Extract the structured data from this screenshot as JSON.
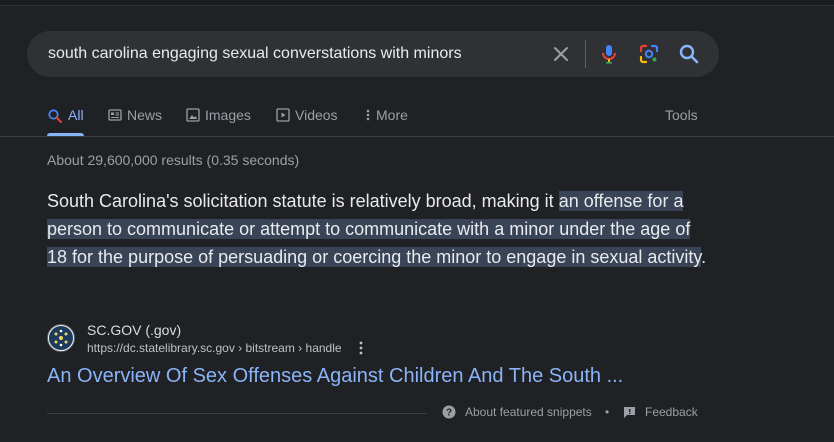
{
  "search": {
    "query": "south carolina engaging sexual converstations with minors"
  },
  "tabs": [
    {
      "label": "All",
      "icon": "search-icon",
      "active": true
    },
    {
      "label": "News",
      "icon": "news-icon"
    },
    {
      "label": "Images",
      "icon": "image-icon"
    },
    {
      "label": "Videos",
      "icon": "video-icon"
    },
    {
      "label": "More",
      "icon": "more-vert-icon"
    }
  ],
  "tools_label": "Tools",
  "result_stats": "About 29,600,000 results (0.35 seconds)",
  "snippet": {
    "plain": "South Carolina's solicitation statute is relatively broad, making it ",
    "highlighted": "an offense for a person to communicate or attempt to communicate with a minor under the age of 18 for the purpose of persuading or coercing the minor to engage in sexual activity",
    "end": "."
  },
  "source": {
    "site_name": "SC.GOV (.gov)",
    "url": "https://dc.statelibrary.sc.gov › bitstream › handle",
    "title": "An Overview Of Sex Offenses Against Children And The South ..."
  },
  "footer": {
    "about_label": "About featured snippets",
    "separator": "•",
    "feedback_label": "Feedback"
  },
  "colors": {
    "background": "#202124",
    "link": "#8ab4f8",
    "highlight": "#394457"
  }
}
